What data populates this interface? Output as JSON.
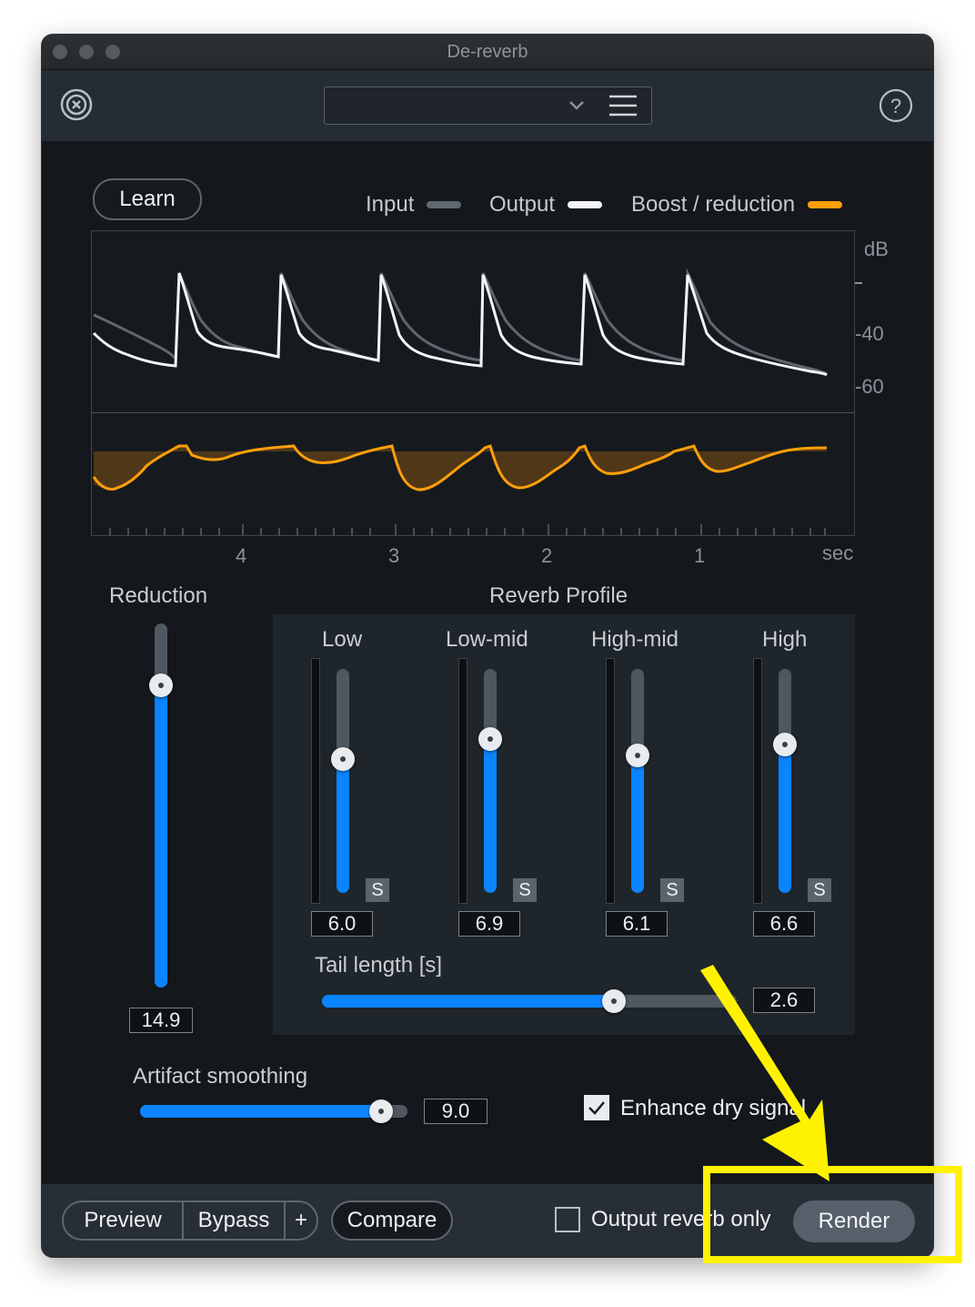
{
  "window": {
    "title": "De-reverb"
  },
  "toolbar": {
    "preset_value": "",
    "logo_icon": "izotope-logo-icon",
    "menu_icon": "hamburger-icon",
    "help_icon": "help-icon"
  },
  "graph": {
    "learn_label": "Learn",
    "legend": [
      {
        "label": "Input",
        "color": "#5f6870"
      },
      {
        "label": "Output",
        "color": "#f2f4f6"
      },
      {
        "label": "Boost / reduction",
        "color": "#ff9f0a"
      }
    ],
    "db_unit": "dB",
    "db_ticks": [
      "-40",
      "-60"
    ],
    "time_ticks": [
      "4",
      "3",
      "2",
      "1"
    ],
    "time_unit": "sec"
  },
  "reduction": {
    "label": "Reduction",
    "value": "14.9",
    "level": 0.83
  },
  "reverb_profile": {
    "title": "Reverb Profile",
    "solo_label": "S",
    "bands": [
      {
        "label": "Low",
        "value": "6.0",
        "level": 0.6
      },
      {
        "label": "Low-mid",
        "value": "6.9",
        "level": 0.69
      },
      {
        "label": "High-mid",
        "value": "6.1",
        "level": 0.61
      },
      {
        "label": "High",
        "value": "6.6",
        "level": 0.66
      }
    ],
    "tail_length": {
      "label": "Tail length [s]",
      "value": "2.6",
      "level": 0.71
    }
  },
  "artifact_smoothing": {
    "label": "Artifact smoothing",
    "value": "9.0",
    "level": 0.9
  },
  "enhance_dry_signal": {
    "label": "Enhance dry signal",
    "checked": true
  },
  "footer": {
    "preview_label": "Preview",
    "bypass_label": "Bypass",
    "plus_label": "+",
    "compare_label": "Compare",
    "output_reverb_only_label": "Output reverb only",
    "output_reverb_only_checked": false,
    "render_label": "Render"
  },
  "annotation": {
    "highlight_color": "#fff200"
  }
}
